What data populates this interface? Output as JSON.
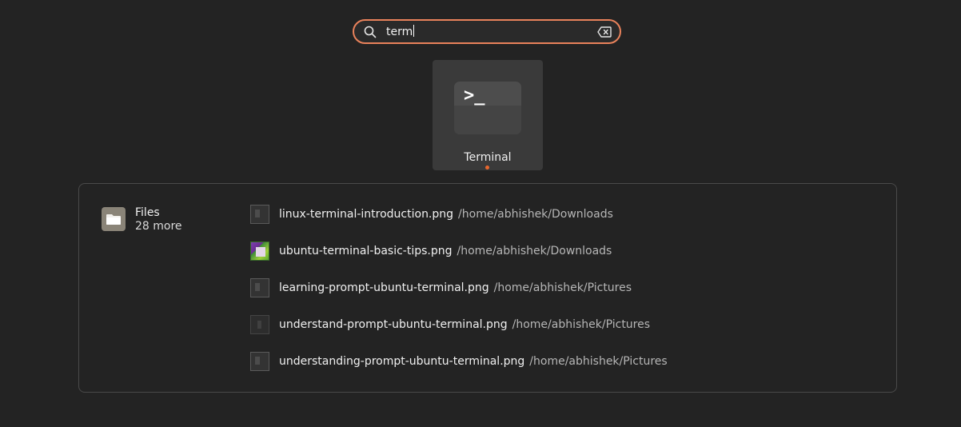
{
  "search": {
    "query": "term",
    "search_icon": "search-icon",
    "clear_icon": "backspace-clear-icon",
    "accent_color": "#e9825b"
  },
  "app_result": {
    "label": "Terminal",
    "icon": "terminal-app-icon",
    "icon_text": ">_",
    "running_indicator_color": "#e9672d"
  },
  "files_provider": {
    "name": "Files",
    "more": "28 more",
    "icon": "folder-icon",
    "items": [
      {
        "name": "linux-terminal-introduction.png",
        "path": "/home/abhishek/Downloads",
        "thumb": "dark"
      },
      {
        "name": "ubuntu-terminal-basic-tips.png",
        "path": "/home/abhishek/Downloads",
        "thumb": "color"
      },
      {
        "name": "learning-prompt-ubuntu-terminal.png",
        "path": "/home/abhishek/Pictures",
        "thumb": "dark"
      },
      {
        "name": "understand-prompt-ubuntu-terminal.png",
        "path": "/home/abhishek/Pictures",
        "thumb": "dim"
      },
      {
        "name": "understanding-prompt-ubuntu-terminal.png",
        "path": "/home/abhishek/Pictures",
        "thumb": "dark"
      }
    ]
  }
}
